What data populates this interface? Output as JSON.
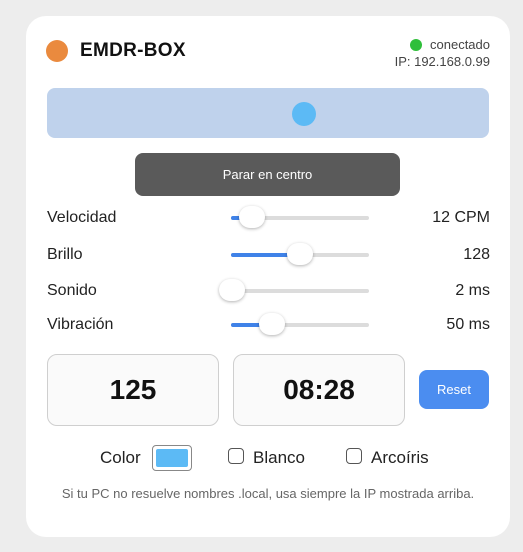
{
  "header": {
    "title": "EMDR-BOX",
    "status_text": "conectado",
    "ip_text": "IP: 192.168.0.99",
    "logo_color": "#ea8a3e",
    "status_color": "#2fbf3a"
  },
  "track": {
    "ball_color": "#5cbaf5"
  },
  "stop_button": {
    "label": "Parar en centro"
  },
  "controls": [
    {
      "label": "Velocidad",
      "value": "12 CPM",
      "level": 0.15
    },
    {
      "label": "Brillo",
      "value": "128",
      "level": 0.5
    },
    {
      "label": "Sonido",
      "value": "2 ms",
      "level": 0.01
    },
    {
      "label": "Vibración",
      "value": "50 ms",
      "level": 0.3
    }
  ],
  "counters": {
    "count": "125",
    "timer": "08:28"
  },
  "reset_button": {
    "label": "Reset"
  },
  "options": {
    "color_label": "Color",
    "color_value": "#5cbaf5",
    "white_label": "Blanco",
    "white_checked": false,
    "rainbow_label": "Arcoíris",
    "rainbow_checked": false
  },
  "footnote": "Si tu PC no resuelve nombres .local, usa siempre la IP mostrada arriba."
}
